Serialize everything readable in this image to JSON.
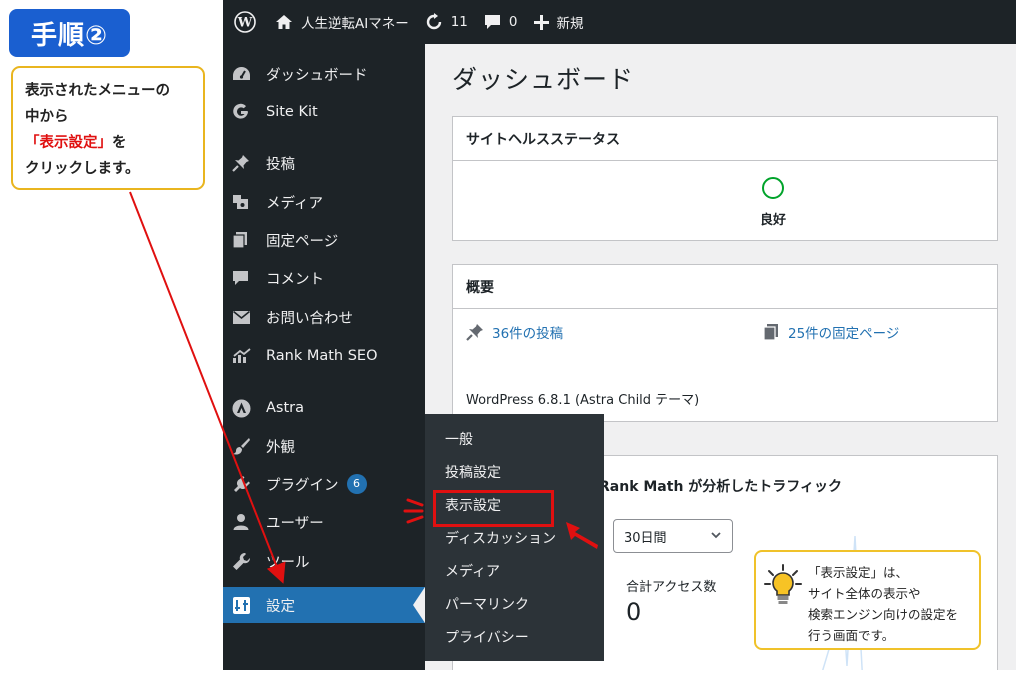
{
  "tutorial": {
    "step_label": "手順②",
    "note": {
      "line1": "表示されたメニューの",
      "line2": "中から",
      "line3_highlight": "「表示設定」",
      "line3_rest": "を",
      "line4": "クリックします。"
    },
    "tip": {
      "line1": "「表示設定」は、",
      "line2": "サイト全体の表示や",
      "line3": "検索エンジン向けの設定を",
      "line4": "行う画面です。",
      "icon": "lightbulb-icon"
    }
  },
  "adminbar": {
    "site_name": "人生逆転AIマネー",
    "updates_count": "11",
    "comments_count": "0",
    "new_label": "新規"
  },
  "sidebar": {
    "items": [
      {
        "label": "ダッシュボード",
        "icon": "dashboard-icon"
      },
      {
        "label": "Site Kit",
        "icon": "google-icon"
      },
      {
        "label": "投稿",
        "icon": "pin-icon"
      },
      {
        "label": "メディア",
        "icon": "media-icon"
      },
      {
        "label": "固定ページ",
        "icon": "pages-icon"
      },
      {
        "label": "コメント",
        "icon": "comment-icon"
      },
      {
        "label": "お問い合わせ",
        "icon": "mail-icon"
      },
      {
        "label": "Rank Math SEO",
        "icon": "chart-icon"
      },
      {
        "label": "Astra",
        "icon": "astra-icon"
      },
      {
        "label": "外観",
        "icon": "brush-icon"
      },
      {
        "label": "プラグイン",
        "icon": "plugin-icon",
        "badge": "6"
      },
      {
        "label": "ユーザー",
        "icon": "user-icon"
      },
      {
        "label": "ツール",
        "icon": "wrench-icon"
      },
      {
        "label": "設定",
        "icon": "settings-icon",
        "active": true
      }
    ]
  },
  "flyout": {
    "items": [
      "一般",
      "投稿設定",
      "表示設定",
      "ディスカッション",
      "メディア",
      "パーマリンク",
      "プライバシー"
    ]
  },
  "main": {
    "page_title": "ダッシュボード",
    "site_health": {
      "title": "サイトヘルスステータス",
      "status": "良好"
    },
    "glance": {
      "title": "概要",
      "posts": "36件の投稿",
      "pages": "25件の固定ページ",
      "version": "WordPress 6.8.1 (Astra Child テーマ)"
    },
    "rankmath": {
      "title": "Rank Math が分析したトラフィック",
      "period": "30日間",
      "stat_label": "合計アクセス数",
      "stat_value": "0"
    }
  },
  "colors": {
    "wp_dark": "#1d2327",
    "wp_blue": "#2271b1",
    "step_blue": "#1a5fd0",
    "annotation_red": "#e01010",
    "note_border": "#e9b51f"
  }
}
